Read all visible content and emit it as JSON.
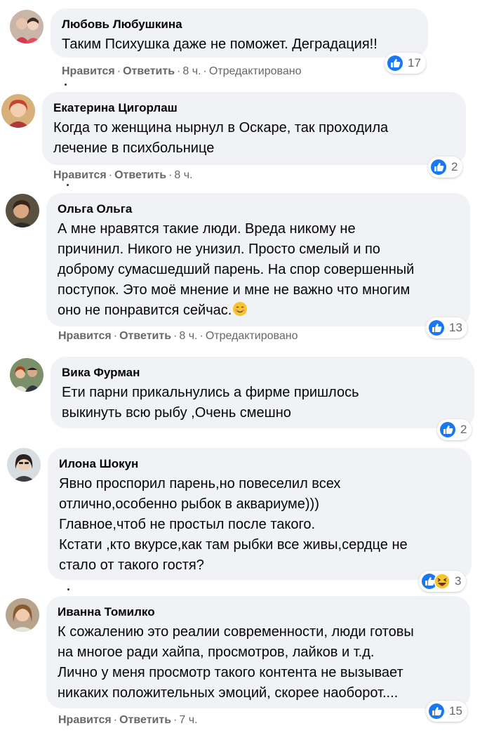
{
  "actions": {
    "like": "Нравится",
    "reply": "Ответить",
    "edited": "Отредактировано"
  },
  "colors": {
    "bubble": "#f0f2f5",
    "like_blue": "#1877f2",
    "meta_gray": "#65676b"
  },
  "comments": [
    {
      "author": "Любовь Любушкина",
      "text": "Таким Психушка даже не поможет. Деградация!!",
      "time": "8 ч.",
      "edited": true,
      "reactions": [
        "like"
      ],
      "count": "17"
    },
    {
      "author": "Екатерина Цигорлаш",
      "text": "Когда то женщина нырнул в Оскаре, так проходила\nлечение в психбольнице",
      "time": "8 ч.",
      "edited": false,
      "reactions": [
        "like"
      ],
      "count": "2"
    },
    {
      "author": "Ольга Ольга",
      "text": "А мне нравятся такие люди. Вреда никому не\nпричинил. Никого не унизил. Просто смелый и по\nдоброму сумасшедший парень. На спор совершенный\nпоступок. Это моё мнение и мне не важно что многим\nоно не понравится сейчас.",
      "emoji": "smiling-face-icon",
      "time": "8 ч.",
      "edited": true,
      "reactions": [
        "like"
      ],
      "count": "13"
    },
    {
      "author": "Вика Фурман",
      "text": "Ети парни прикальнулись а фирме пришлось\nвыкинуть всю рыбу ,Очень смешно",
      "time": "",
      "edited": false,
      "reactions": [
        "like"
      ],
      "count": "2"
    },
    {
      "author": "Илона Шокун",
      "text": "Явно проспорил парень,но повеселил всех\nотлично,особенно рыбок в аквариуме)))\nГлавное,чтоб не простыл после такого.\nКстати ,кто вкурсе,как там рыбки все живы,сердце не\nстало от такого гостя?",
      "time": "",
      "edited": false,
      "reactions": [
        "like",
        "haha"
      ],
      "count": "3"
    },
    {
      "author": "Иванна Томилко",
      "text": "К сожалению это реалии современности, люди готовы\nна многое ради хайпа, просмотров, лайков и т.д.\nЛично у меня просмотр такого контента не вызывает\nникаких положительных эмоций, скорее наоборот....",
      "time": "7 ч.",
      "edited": false,
      "reactions": [
        "like"
      ],
      "count": "15"
    }
  ]
}
